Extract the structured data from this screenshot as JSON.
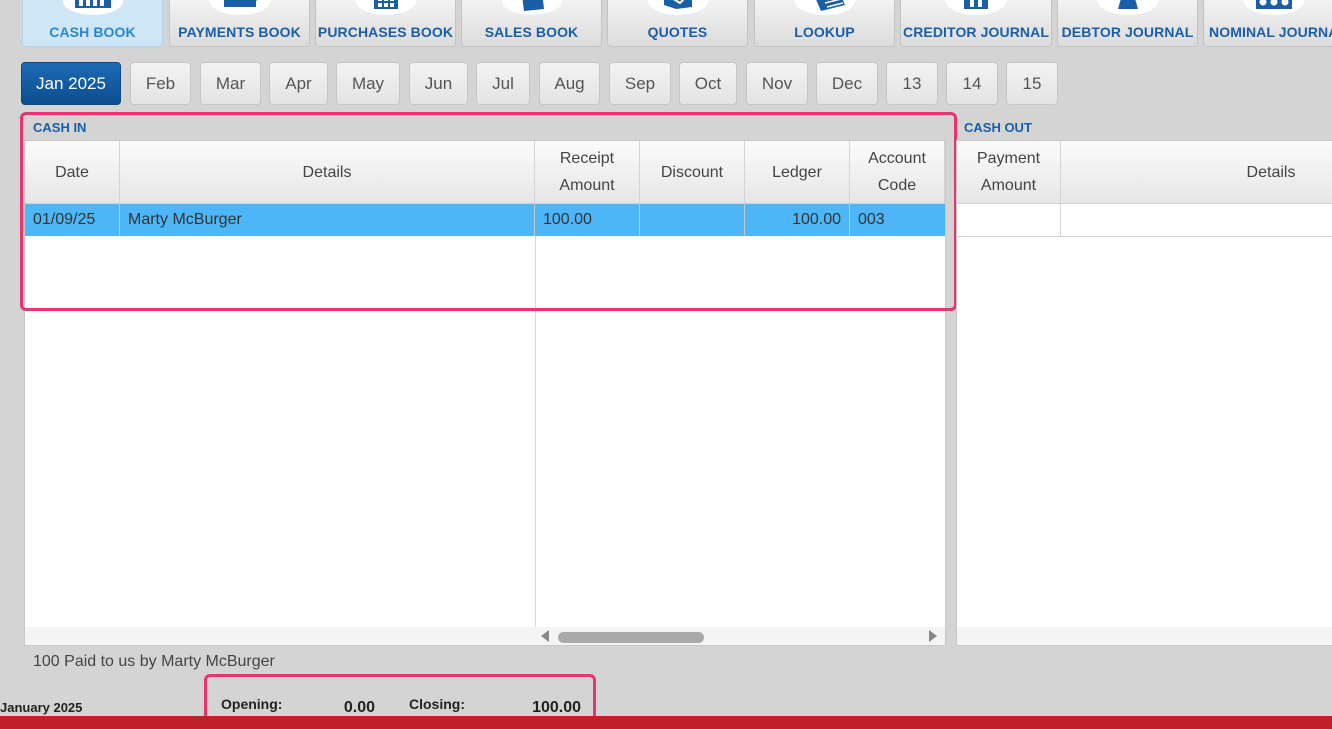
{
  "toolbar": {
    "cash_book": "CASH BOOK",
    "payments_book": "PAYMENTS BOOK",
    "purchases_book": "PURCHASES BOOK",
    "sales_book": "SALES BOOK",
    "quotes": "QUOTES",
    "lookup": "LOOKUP",
    "creditor_journal": "CREDITOR JOURNAL",
    "debtor_journal": "DEBTOR JOURNAL",
    "nominal_journal": "NOMINAL JOURNAL",
    "active": "cash_book"
  },
  "months": [
    "Jan 2025",
    "Feb",
    "Mar",
    "Apr",
    "May",
    "Jun",
    "Jul",
    "Aug",
    "Sep",
    "Oct",
    "Nov",
    "Dec",
    "13",
    "14",
    "15"
  ],
  "active_month": "Jan 2025",
  "cash_in": {
    "title": "CASH IN",
    "columns": {
      "date": "Date",
      "details": "Details",
      "receipt_amount": "Receipt Amount",
      "discount": "Discount",
      "ledger": "Ledger",
      "account_code": "Account Code"
    },
    "rows": [
      {
        "date": "01/09/25",
        "details": "Marty McBurger",
        "receipt_amount": "100.00",
        "discount": "",
        "ledger": "100.00",
        "account_code": "003"
      }
    ]
  },
  "cash_out": {
    "title": "CASH OUT",
    "columns": {
      "payment_amount": "Payment Amount",
      "details": "Details"
    }
  },
  "status": {
    "description": "100 Paid to us by Marty McBurger",
    "period": "January 2025",
    "opening_label": "Opening:",
    "opening_value": "0.00",
    "closing_label": "Closing:",
    "closing_value": "100.00"
  },
  "colors": {
    "brand_blue": "#1a5ea8",
    "selected_row": "#4db6f6",
    "highlight": "#e8336d",
    "footer_bar": "#c0202a"
  }
}
